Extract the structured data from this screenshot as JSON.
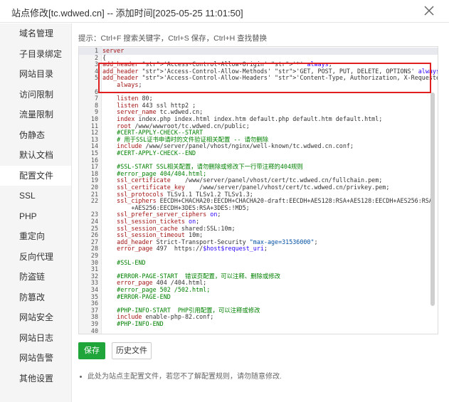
{
  "window": {
    "title": "站点修改[tc.wdwed.cn] -- 添加时间[2025-05-25 11:01:50]"
  },
  "sidebar": {
    "items": [
      {
        "label": "域名管理"
      },
      {
        "label": "子目录绑定"
      },
      {
        "label": "网站目录"
      },
      {
        "label": "访问限制"
      },
      {
        "label": "流量限制"
      },
      {
        "label": "伪静态"
      },
      {
        "label": "默认文档"
      },
      {
        "label": "配置文件",
        "active": true
      },
      {
        "label": "SSL"
      },
      {
        "label": "PHP"
      },
      {
        "label": "重定向"
      },
      {
        "label": "反向代理"
      },
      {
        "label": "防盗链"
      },
      {
        "label": "防篡改"
      },
      {
        "label": "网站安全"
      },
      {
        "label": "网站日志"
      },
      {
        "label": "网站告警"
      },
      {
        "label": "其他设置"
      }
    ]
  },
  "main": {
    "tip": "提示：Ctrl+F 搜索关键字，Ctrl+S 保存，Ctrl+H 查找替换",
    "save_label": "保存",
    "history_label": "历史文件",
    "note": "此处为站点主配置文件，若您不了解配置规则，请勿随意修改."
  },
  "editor": {
    "lines": [
      {
        "n": "1",
        "code": "server"
      },
      {
        "n": "2",
        "code": "{"
      },
      {
        "n": "3",
        "code": "add_header 'Access-Control-Allow-Origin' '*' always;"
      },
      {
        "n": "4",
        "code": "add_header 'Access-Control-Allow-Methods' 'GET, POST, PUT, DELETE, OPTIONS' always;"
      },
      {
        "n": "5",
        "code": "add_header 'Access-Control-Allow-Headers' 'Content-Type, Authorization, X-Requested-With'"
      },
      {
        "n": "",
        "code": "    always;"
      },
      {
        "n": "6",
        "code": ""
      },
      {
        "n": "7",
        "code": "    listen 80;"
      },
      {
        "n": "8",
        "code": "    listen 443 ssl http2 ;"
      },
      {
        "n": "9",
        "code": "    server_name tc.wdwed.cn;"
      },
      {
        "n": "10",
        "code": "    index index.php index.html index.htm default.php default.htm default.html;"
      },
      {
        "n": "11",
        "code": "    root /www/wwwroot/tc.wdwed.cn/public;"
      },
      {
        "n": "12",
        "code": "    #CERT-APPLY-CHECK--START"
      },
      {
        "n": "13",
        "code": "    # 用于SSL证书申请时的文件验证相关配置 -- 请勿删除"
      },
      {
        "n": "14",
        "code": "    include /www/server/panel/vhost/nginx/well-known/tc.wdwed.cn.conf;"
      },
      {
        "n": "15",
        "code": "    #CERT-APPLY-CHECK--END"
      },
      {
        "n": "16",
        "code": ""
      },
      {
        "n": "17",
        "code": "    #SSL-START SSL相关配置，请勿删除或修改下一行带注释的404规则"
      },
      {
        "n": "18",
        "code": "    #error_page 404/404.html;"
      },
      {
        "n": "19",
        "code": "    ssl_certificate    /www/server/panel/vhost/cert/tc.wdwed.cn/fullchain.pem;"
      },
      {
        "n": "20",
        "code": "    ssl_certificate_key    /www/server/panel/vhost/cert/tc.wdwed.cn/privkey.pem;"
      },
      {
        "n": "21",
        "code": "    ssl_protocols TLSv1.1 TLSv1.2 TLSv1.3;"
      },
      {
        "n": "22",
        "code": "    ssl_ciphers EECDH+CHACHA20:EECDH+CHACHA20-draft:EECDH+AES128:RSA+AES128:EECDH+AES256:RSA"
      },
      {
        "n": "",
        "code": "        +AES256:EECDH+3DES:RSA+3DES:!MD5;"
      },
      {
        "n": "23",
        "code": "    ssl_prefer_server_ciphers on;"
      },
      {
        "n": "24",
        "code": "    ssl_session_tickets on;"
      },
      {
        "n": "25",
        "code": "    ssl_session_cache shared:SSL:10m;"
      },
      {
        "n": "26",
        "code": "    ssl_session_timeout 10m;"
      },
      {
        "n": "27",
        "code": "    add_header Strict-Transport-Security \"max-age=31536000\";"
      },
      {
        "n": "28",
        "code": "    error_page 497  https://$host$request_uri;"
      },
      {
        "n": "29",
        "code": ""
      },
      {
        "n": "30",
        "code": "    #SSL-END"
      },
      {
        "n": "31",
        "code": ""
      },
      {
        "n": "32",
        "code": "    #ERROR-PAGE-START  错误页配置，可以注释、删除或修改"
      },
      {
        "n": "33",
        "code": "    error_page 404 /404.html;"
      },
      {
        "n": "34",
        "code": "    #error_page 502 /502.html;"
      },
      {
        "n": "35",
        "code": "    #ERROR-PAGE-END"
      },
      {
        "n": "36",
        "code": ""
      },
      {
        "n": "37",
        "code": "    #PHP-INFO-START  PHP引用配置，可以注释或修改"
      },
      {
        "n": "38",
        "code": "    include enable-php-82.conf;"
      },
      {
        "n": "39",
        "code": "    #PHP-INFO-END"
      },
      {
        "n": "40",
        "code": ""
      }
    ]
  },
  "icons": {
    "close": "close-icon"
  },
  "colors": {
    "accent": "#20a53a",
    "highlight_box": "#e02020",
    "sidebar_bg": "#f5f5f5"
  }
}
